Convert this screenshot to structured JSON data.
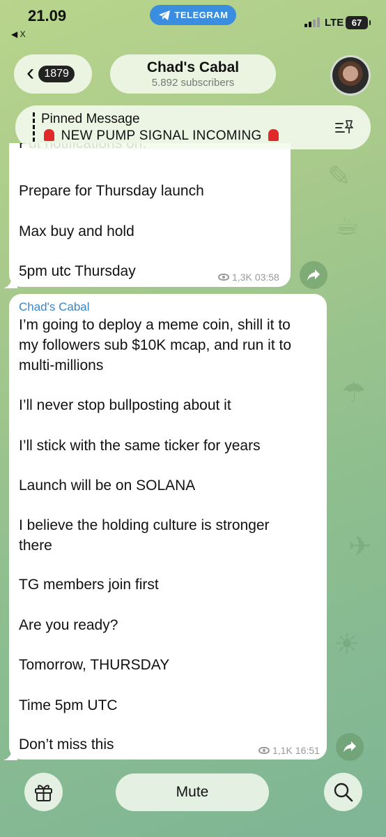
{
  "status_bar": {
    "time": "21.09",
    "back_app": "◀ X",
    "telegram_pill": "TELEGRAM",
    "network": "LTE",
    "battery": "67"
  },
  "header": {
    "unread_count": "1879",
    "channel_title": "Chad's Cabal",
    "subscribers": "5.892 subscribers"
  },
  "pinned": {
    "title": "Pinned Message",
    "text": "NEW PUMP SIGNAL INCOMING"
  },
  "messages": [
    {
      "cut_line": "Put notifications on.",
      "lines": [
        "Prepare for Thursday launch",
        "Max buy and hold",
        "5pm utc Thursday"
      ],
      "views": "1,3K",
      "time": "03:58"
    },
    {
      "sender": "Chad's Cabal",
      "lines": [
        "I’m going to deploy a meme coin, shill it to",
        "my followers sub $10K mcap, and run it to",
        "multi-millions",
        "I’ll never stop bullposting about it",
        "I’ll stick with the same ticker for years",
        "Launch will be on SOLANA",
        "I believe the holding culture is stronger",
        "there",
        "TG members join first",
        "Are you ready?",
        "Tomorrow, THURSDAY",
        "Time 5pm UTC",
        "Don’t miss this"
      ],
      "views": "1,1K",
      "time": "16:51"
    }
  ],
  "bottom_bar": {
    "mute_label": "Mute"
  }
}
